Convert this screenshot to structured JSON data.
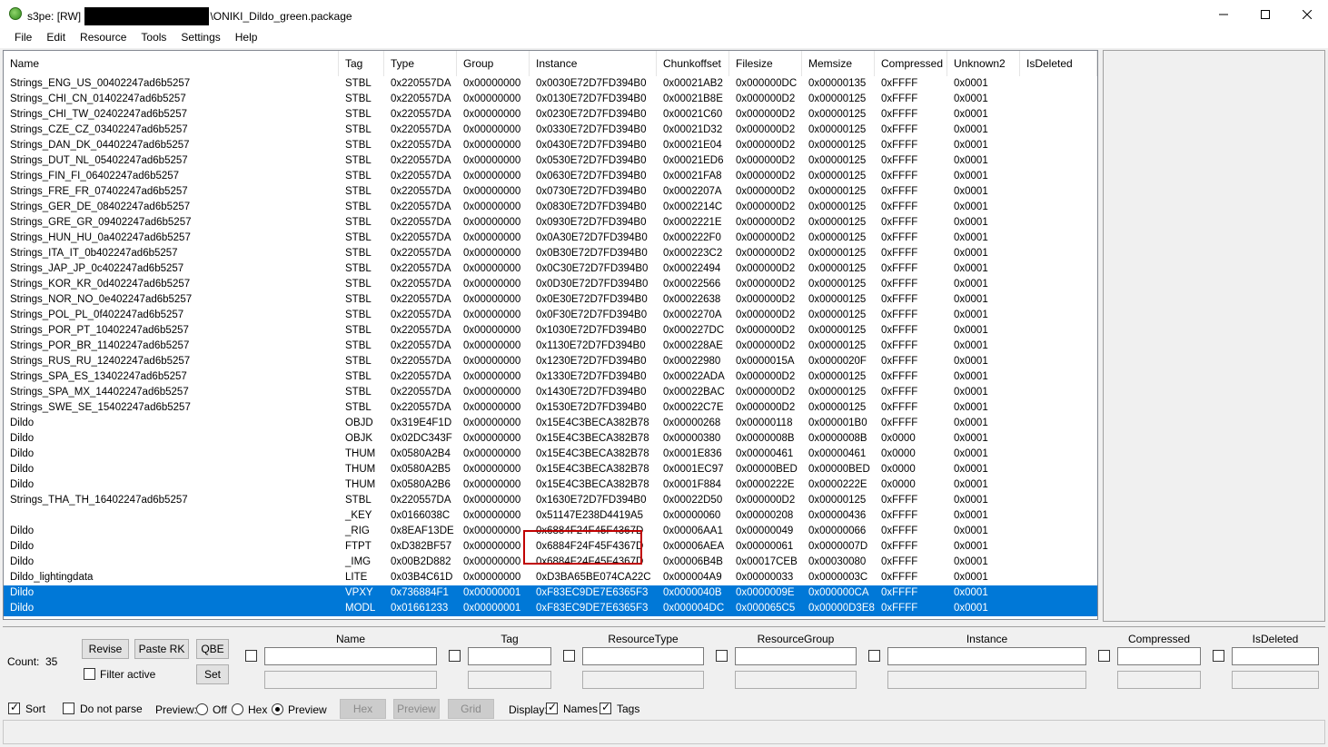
{
  "window": {
    "title_prefix": "s3pe: [RW] ",
    "title_suffix": "\\ONIKI_Dildo_green.package",
    "minimize_icon": "minimize-icon",
    "maximize_icon": "maximize-icon",
    "close_icon": "close-icon"
  },
  "menu": [
    "File",
    "Edit",
    "Resource",
    "Tools",
    "Settings",
    "Help"
  ],
  "columns": [
    "Name",
    "Tag",
    "Type",
    "Group",
    "Instance",
    "Chunkoffset",
    "Filesize",
    "Memsize",
    "Compressed",
    "Unknown2",
    "IsDeleted"
  ],
  "rows": [
    [
      "Strings_ENG_US_00402247ad6b5257",
      "STBL",
      "0x220557DA",
      "0x00000000",
      "0x0030E72D7FD394B0",
      "0x00021AB2",
      "0x000000DC",
      "0x00000135",
      "0xFFFF",
      "0x0001",
      ""
    ],
    [
      "Strings_CHI_CN_01402247ad6b5257",
      "STBL",
      "0x220557DA",
      "0x00000000",
      "0x0130E72D7FD394B0",
      "0x00021B8E",
      "0x000000D2",
      "0x00000125",
      "0xFFFF",
      "0x0001",
      ""
    ],
    [
      "Strings_CHI_TW_02402247ad6b5257",
      "STBL",
      "0x220557DA",
      "0x00000000",
      "0x0230E72D7FD394B0",
      "0x00021C60",
      "0x000000D2",
      "0x00000125",
      "0xFFFF",
      "0x0001",
      ""
    ],
    [
      "Strings_CZE_CZ_03402247ad6b5257",
      "STBL",
      "0x220557DA",
      "0x00000000",
      "0x0330E72D7FD394B0",
      "0x00021D32",
      "0x000000D2",
      "0x00000125",
      "0xFFFF",
      "0x0001",
      ""
    ],
    [
      "Strings_DAN_DK_04402247ad6b5257",
      "STBL",
      "0x220557DA",
      "0x00000000",
      "0x0430E72D7FD394B0",
      "0x00021E04",
      "0x000000D2",
      "0x00000125",
      "0xFFFF",
      "0x0001",
      ""
    ],
    [
      "Strings_DUT_NL_05402247ad6b5257",
      "STBL",
      "0x220557DA",
      "0x00000000",
      "0x0530E72D7FD394B0",
      "0x00021ED6",
      "0x000000D2",
      "0x00000125",
      "0xFFFF",
      "0x0001",
      ""
    ],
    [
      "Strings_FIN_FI_06402247ad6b5257",
      "STBL",
      "0x220557DA",
      "0x00000000",
      "0x0630E72D7FD394B0",
      "0x00021FA8",
      "0x000000D2",
      "0x00000125",
      "0xFFFF",
      "0x0001",
      ""
    ],
    [
      "Strings_FRE_FR_07402247ad6b5257",
      "STBL",
      "0x220557DA",
      "0x00000000",
      "0x0730E72D7FD394B0",
      "0x0002207A",
      "0x000000D2",
      "0x00000125",
      "0xFFFF",
      "0x0001",
      ""
    ],
    [
      "Strings_GER_DE_08402247ad6b5257",
      "STBL",
      "0x220557DA",
      "0x00000000",
      "0x0830E72D7FD394B0",
      "0x0002214C",
      "0x000000D2",
      "0x00000125",
      "0xFFFF",
      "0x0001",
      ""
    ],
    [
      "Strings_GRE_GR_09402247ad6b5257",
      "STBL",
      "0x220557DA",
      "0x00000000",
      "0x0930E72D7FD394B0",
      "0x0002221E",
      "0x000000D2",
      "0x00000125",
      "0xFFFF",
      "0x0001",
      ""
    ],
    [
      "Strings_HUN_HU_0a402247ad6b5257",
      "STBL",
      "0x220557DA",
      "0x00000000",
      "0x0A30E72D7FD394B0",
      "0x000222F0",
      "0x000000D2",
      "0x00000125",
      "0xFFFF",
      "0x0001",
      ""
    ],
    [
      "Strings_ITA_IT_0b402247ad6b5257",
      "STBL",
      "0x220557DA",
      "0x00000000",
      "0x0B30E72D7FD394B0",
      "0x000223C2",
      "0x000000D2",
      "0x00000125",
      "0xFFFF",
      "0x0001",
      ""
    ],
    [
      "Strings_JAP_JP_0c402247ad6b5257",
      "STBL",
      "0x220557DA",
      "0x00000000",
      "0x0C30E72D7FD394B0",
      "0x00022494",
      "0x000000D2",
      "0x00000125",
      "0xFFFF",
      "0x0001",
      ""
    ],
    [
      "Strings_KOR_KR_0d402247ad6b5257",
      "STBL",
      "0x220557DA",
      "0x00000000",
      "0x0D30E72D7FD394B0",
      "0x00022566",
      "0x000000D2",
      "0x00000125",
      "0xFFFF",
      "0x0001",
      ""
    ],
    [
      "Strings_NOR_NO_0e402247ad6b5257",
      "STBL",
      "0x220557DA",
      "0x00000000",
      "0x0E30E72D7FD394B0",
      "0x00022638",
      "0x000000D2",
      "0x00000125",
      "0xFFFF",
      "0x0001",
      ""
    ],
    [
      "Strings_POL_PL_0f402247ad6b5257",
      "STBL",
      "0x220557DA",
      "0x00000000",
      "0x0F30E72D7FD394B0",
      "0x0002270A",
      "0x000000D2",
      "0x00000125",
      "0xFFFF",
      "0x0001",
      ""
    ],
    [
      "Strings_POR_PT_10402247ad6b5257",
      "STBL",
      "0x220557DA",
      "0x00000000",
      "0x1030E72D7FD394B0",
      "0x000227DC",
      "0x000000D2",
      "0x00000125",
      "0xFFFF",
      "0x0001",
      ""
    ],
    [
      "Strings_POR_BR_11402247ad6b5257",
      "STBL",
      "0x220557DA",
      "0x00000000",
      "0x1130E72D7FD394B0",
      "0x000228AE",
      "0x000000D2",
      "0x00000125",
      "0xFFFF",
      "0x0001",
      ""
    ],
    [
      "Strings_RUS_RU_12402247ad6b5257",
      "STBL",
      "0x220557DA",
      "0x00000000",
      "0x1230E72D7FD394B0",
      "0x00022980",
      "0x0000015A",
      "0x0000020F",
      "0xFFFF",
      "0x0001",
      ""
    ],
    [
      "Strings_SPA_ES_13402247ad6b5257",
      "STBL",
      "0x220557DA",
      "0x00000000",
      "0x1330E72D7FD394B0",
      "0x00022ADA",
      "0x000000D2",
      "0x00000125",
      "0xFFFF",
      "0x0001",
      ""
    ],
    [
      "Strings_SPA_MX_14402247ad6b5257",
      "STBL",
      "0x220557DA",
      "0x00000000",
      "0x1430E72D7FD394B0",
      "0x00022BAC",
      "0x000000D2",
      "0x00000125",
      "0xFFFF",
      "0x0001",
      ""
    ],
    [
      "Strings_SWE_SE_15402247ad6b5257",
      "STBL",
      "0x220557DA",
      "0x00000000",
      "0x1530E72D7FD394B0",
      "0x00022C7E",
      "0x000000D2",
      "0x00000125",
      "0xFFFF",
      "0x0001",
      ""
    ],
    [
      "Dildo",
      "OBJD",
      "0x319E4F1D",
      "0x00000000",
      "0x15E4C3BECA382B78",
      "0x00000268",
      "0x00000118",
      "0x000001B0",
      "0xFFFF",
      "0x0001",
      ""
    ],
    [
      "Dildo",
      "OBJK",
      "0x02DC343F",
      "0x00000000",
      "0x15E4C3BECA382B78",
      "0x00000380",
      "0x0000008B",
      "0x0000008B",
      "0x0000",
      "0x0001",
      ""
    ],
    [
      "Dildo",
      "THUM",
      "0x0580A2B4",
      "0x00000000",
      "0x15E4C3BECA382B78",
      "0x0001E836",
      "0x00000461",
      "0x00000461",
      "0x0000",
      "0x0001",
      ""
    ],
    [
      "Dildo",
      "THUM",
      "0x0580A2B5",
      "0x00000000",
      "0x15E4C3BECA382B78",
      "0x0001EC97",
      "0x00000BED",
      "0x00000BED",
      "0x0000",
      "0x0001",
      ""
    ],
    [
      "Dildo",
      "THUM",
      "0x0580A2B6",
      "0x00000000",
      "0x15E4C3BECA382B78",
      "0x0001F884",
      "0x0000222E",
      "0x0000222E",
      "0x0000",
      "0x0001",
      ""
    ],
    [
      "Strings_THA_TH_16402247ad6b5257",
      "STBL",
      "0x220557DA",
      "0x00000000",
      "0x1630E72D7FD394B0",
      "0x00022D50",
      "0x000000D2",
      "0x00000125",
      "0xFFFF",
      "0x0001",
      ""
    ],
    [
      "",
      "_KEY",
      "0x0166038C",
      "0x00000000",
      "0x51147E238D4419A5",
      "0x00000060",
      "0x00000208",
      "0x00000436",
      "0xFFFF",
      "0x0001",
      ""
    ],
    [
      "Dildo",
      "_RIG",
      "0x8EAF13DE",
      "0x00000000",
      "0x6884F24F45F4367D",
      "0x00006AA1",
      "0x00000049",
      "0x00000066",
      "0xFFFF",
      "0x0001",
      ""
    ],
    [
      "Dildo",
      "FTPT",
      "0xD382BF57",
      "0x00000000",
      "0x6884F24F45F4367D",
      "0x00006AEA",
      "0x00000061",
      "0x0000007D",
      "0xFFFF",
      "0x0001",
      ""
    ],
    [
      "Dildo",
      "_IMG",
      "0x00B2D882",
      "0x00000000",
      "0x6884F24F45F4367D",
      "0x00006B4B",
      "0x00017CEB",
      "0x00030080",
      "0xFFFF",
      "0x0001",
      ""
    ],
    [
      "Dildo_lightingdata",
      "LITE",
      "0x03B4C61D",
      "0x00000000",
      "0xD3BA65BE074CA22C",
      "0x000004A9",
      "0x00000033",
      "0x0000003C",
      "0xFFFF",
      "0x0001",
      ""
    ],
    [
      "Dildo",
      "VPXY",
      "0x736884F1",
      "0x00000001",
      "0xF83EC9DE7E6365F3",
      "0x0000040B",
      "0x0000009E",
      "0x000000CA",
      "0xFFFF",
      "0x0001",
      ""
    ],
    [
      "Dildo",
      "MODL",
      "0x01661233",
      "0x00000001",
      "0xF83EC9DE7E6365F3",
      "0x000004DC",
      "0x000065C5",
      "0x00000D3E8",
      "0xFFFF",
      "0x0001",
      ""
    ]
  ],
  "selected_rows": [
    33,
    34
  ],
  "colors": {
    "selection": "#0078d7",
    "highlight_box": "#c00000"
  },
  "bottom": {
    "count_label": "Count:",
    "count_value": "35",
    "revise_label": "Revise",
    "paste_rk_label": "Paste RK",
    "qbe_label": "QBE",
    "set_label": "Set",
    "filter_active_label": "Filter active",
    "sort_label": "Sort",
    "do_not_parse_label": "Do not parse",
    "preview_label": "Preview:",
    "off_label": "Off",
    "hex_label": "Hex",
    "preview_radio_label": "Preview",
    "hex_btn": "Hex",
    "preview_btn": "Preview",
    "grid_btn": "Grid",
    "display_label": "Display:",
    "names_label": "Names",
    "tags_label": "Tags",
    "filter_fields": [
      "Name",
      "Tag",
      "ResourceType",
      "ResourceGroup",
      "Instance",
      "Compressed",
      "IsDeleted"
    ]
  }
}
